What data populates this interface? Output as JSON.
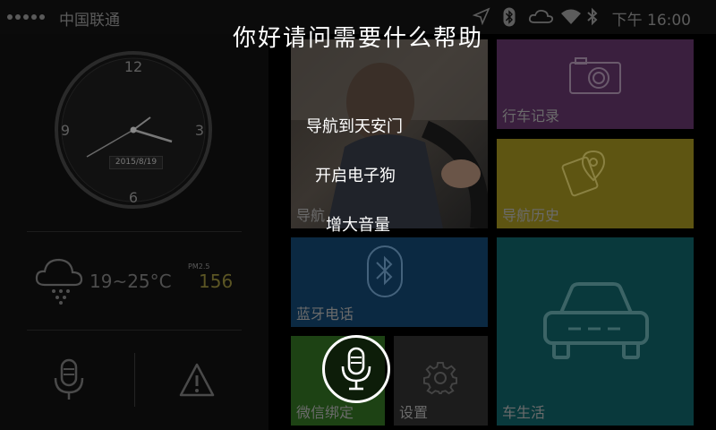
{
  "status_bar": {
    "carrier": "中国联通",
    "time": "下午 16:00",
    "icons": [
      "signal-dots-icon",
      "location-arrow-icon",
      "bluetooth-icon",
      "cloud-icon",
      "wifi-icon",
      "bluetooth-icon"
    ]
  },
  "clock": {
    "numerals": {
      "n12": "12",
      "n3": "3",
      "n6": "6",
      "n9": "9"
    },
    "date": "2015/8/19"
  },
  "weather": {
    "icon": "cloud-snow-icon",
    "temperature": "19~25°C",
    "pm_label": "PM2.5",
    "pm_value": "156"
  },
  "quick_actions": {
    "mic_icon": "microphone-icon",
    "warning_icon": "warning-icon"
  },
  "tiles": {
    "navigation": {
      "label": "导航"
    },
    "drive_record": {
      "label": "行车记录",
      "icon": "camera-icon"
    },
    "nav_history": {
      "label": "导航历史",
      "icon": "map-pin-note-icon"
    },
    "bluetooth_phone": {
      "label": "蓝牙电话",
      "icon": "bluetooth-icon"
    },
    "car_life": {
      "label": "车生活",
      "icon": "car-icon"
    },
    "wechat_bind": {
      "label": "微信绑定"
    },
    "settings": {
      "label": "设置",
      "icon": "gear-icon"
    }
  },
  "colors": {
    "drive_record": "#3a1f3e",
    "nav_history": "#5e5512",
    "bluetooth_phone": "#0b2942",
    "car_life": "#09393c",
    "wechat_bind": "#1d4214",
    "settings": "#1c1c1c"
  },
  "voice": {
    "prompt": "你好请问需要什么帮助",
    "suggestions": [
      "导航到天安门",
      "开启电子狗",
      "增大音量"
    ],
    "mic_icon": "microphone-icon"
  }
}
